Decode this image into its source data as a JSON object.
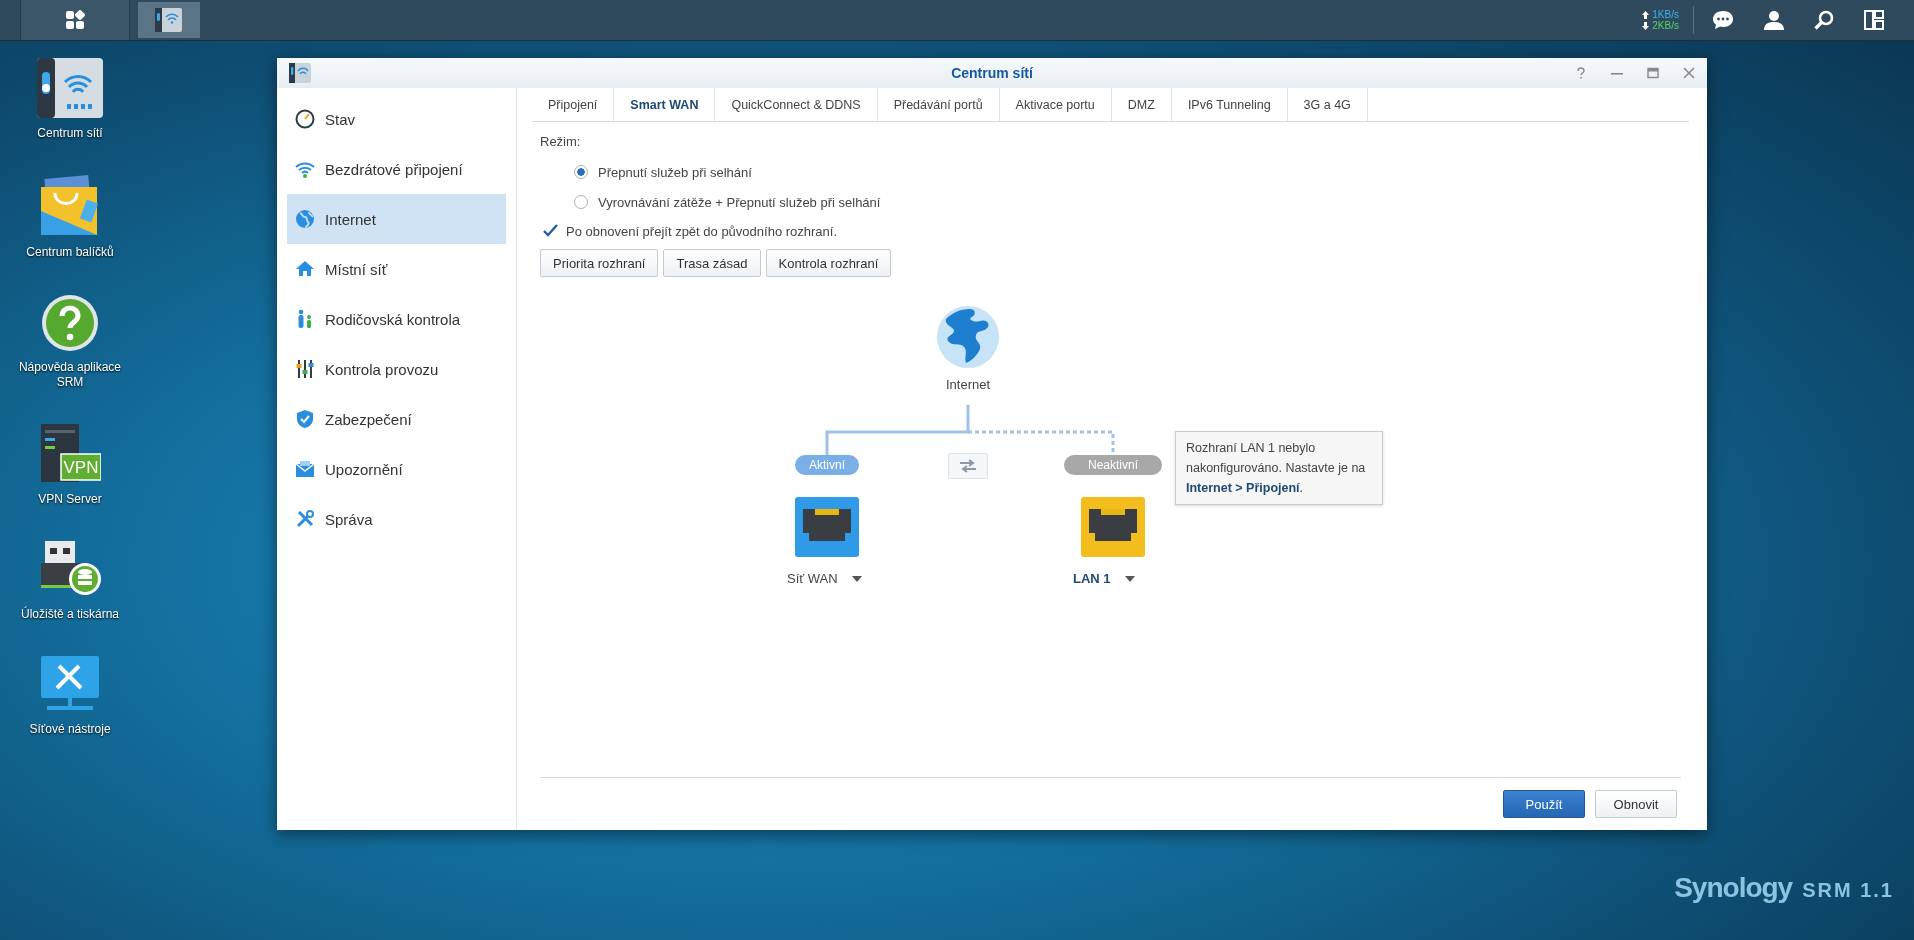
{
  "taskbar": {
    "apps": [
      {
        "kind": "network",
        "selected": true
      }
    ],
    "upload": "1KB/s",
    "download": "2KB/s"
  },
  "desktop_icons": [
    {
      "label": "Centrum sítí",
      "kind": "router"
    },
    {
      "label": "Centrum balíčků",
      "kind": "package"
    },
    {
      "label": "Nápověda aplikace SRM",
      "kind": "help"
    },
    {
      "label": "VPN Server",
      "kind": "vpn",
      "badge": "VPN"
    },
    {
      "label": "Úložiště a tiskárna",
      "kind": "storage"
    },
    {
      "label": "Síťové nástroje",
      "kind": "tools"
    }
  ],
  "window": {
    "title": "Centrum sítí",
    "sidebar": {
      "items": [
        {
          "label": "Stav",
          "kind": "gauge",
          "selected": false
        },
        {
          "label": "Bezdrátové připojení",
          "kind": "wifi",
          "selected": false
        },
        {
          "label": "Internet",
          "kind": "globe",
          "selected": true
        },
        {
          "label": "Místní síť",
          "kind": "house",
          "selected": false
        },
        {
          "label": "Rodičovská kontrola",
          "kind": "family",
          "selected": false
        },
        {
          "label": "Kontrola provozu",
          "kind": "sliders",
          "selected": false
        },
        {
          "label": "Zabezpečení",
          "kind": "shield",
          "selected": false
        },
        {
          "label": "Upozornění",
          "kind": "mail",
          "selected": false
        },
        {
          "label": "Správa",
          "kind": "tools",
          "selected": false
        }
      ]
    },
    "tabs": [
      {
        "label": "Připojení",
        "selected": false
      },
      {
        "label": "Smart WAN",
        "selected": true
      },
      {
        "label": "QuickConnect & DDNS",
        "selected": false
      },
      {
        "label": "Předávání portů",
        "selected": false
      },
      {
        "label": "Aktivace portu",
        "selected": false
      },
      {
        "label": "DMZ",
        "selected": false
      },
      {
        "label": "IPv6 Tunneling",
        "selected": false
      },
      {
        "label": "3G a 4G",
        "selected": false
      }
    ],
    "mode_label": "Režim:",
    "modes": [
      {
        "label": "Přepnutí služeb při selhání",
        "selected": true
      },
      {
        "label": "Vyrovnávání zátěže + Přepnutí služeb při selhání",
        "selected": false
      }
    ],
    "fallback": {
      "label": "Po obnovení přejít zpět do původního rozhraní.",
      "checked": true
    },
    "section_buttons": [
      "Priorita rozhraní",
      "Trasa zásad",
      "Kontrola rozhraní"
    ],
    "diagram": {
      "internet_label": "Internet",
      "interfaces": [
        {
          "status": "Aktivní",
          "active": true,
          "name": "Síť WAN",
          "kind": "wan",
          "highlighted": false
        },
        {
          "status": "Neaktivní",
          "active": false,
          "name": "LAN 1",
          "kind": "lan",
          "highlighted": true
        }
      ],
      "tooltip": "Rozhraní LAN 1 nebylo nakonfigurováno. Nastavte je na **Internet > Připojení**."
    },
    "footer_buttons": [
      {
        "label": "Použít",
        "kind": "primary"
      },
      {
        "label": "Obnovit",
        "kind": "default"
      }
    ]
  },
  "branding": {
    "logo": "Synology",
    "product": "SRM 1.1"
  }
}
